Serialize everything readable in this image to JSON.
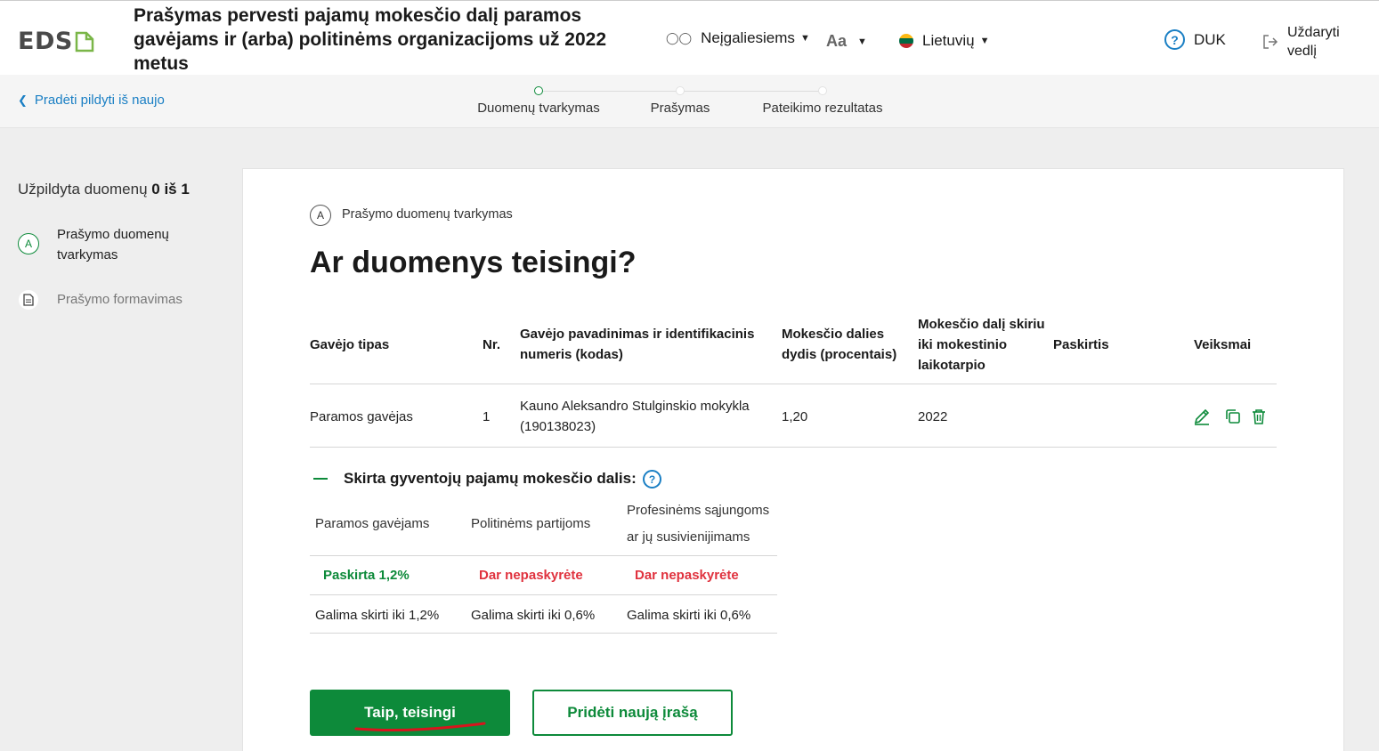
{
  "header": {
    "logo_text": "EDS",
    "title": "Prašymas pervesti pajamų mokesčio dalį paramos gavėjams ir (arba) politinėms organizacijoms už 2022 metus",
    "accessibility_label": "Neįgaliesiems",
    "font_size_label": "Aa",
    "language_label": "Lietuvių",
    "faq_label": "DUK",
    "close_label": "Uždaryti vedlį"
  },
  "stepper": {
    "restart_label": "Pradėti pildyti iš naujo",
    "steps": [
      {
        "label": "Duomenų tvarkymas",
        "active": true
      },
      {
        "label": "Prašymas",
        "active": false
      },
      {
        "label": "Pateikimo rezultatas",
        "active": false
      }
    ]
  },
  "sidebar": {
    "filled_prefix": "Užpildyta duomenų",
    "filled_count": "0 iš 1",
    "items": [
      {
        "badge": "A",
        "label": "Prašymo duomenų tvarkymas"
      },
      {
        "label": "Prašymo formavimas"
      }
    ]
  },
  "main": {
    "section_badge": "A",
    "section_label": "Prašymo duomenų tvarkymas",
    "question": "Ar duomenys teisingi?",
    "table": {
      "headers": [
        "Gavėjo tipas",
        "Nr.",
        "Gavėjo pavadinimas ir identifikacinis numeris (kodas)",
        "Mokesčio dalies dydis (procentais)",
        "Mokesčio dalį skiriu iki mokestinio laikotarpio",
        "Paskirtis",
        "Veiksmai"
      ],
      "rows": [
        {
          "type": "Paramos gavėjas",
          "nr": "1",
          "name": "Kauno Aleksandro Stulginskio mokykla (190138023)",
          "percent": "1,20",
          "until": "2022",
          "purpose": ""
        }
      ]
    },
    "allocation": {
      "title": "Skirta gyventojų pajamų mokesčio dalis:",
      "columns": [
        {
          "header": "Paramos gavėjams",
          "status": "Paskirta 1,2%",
          "status_color": "#0d8a3a",
          "limit": "Galima skirti iki 1,2%"
        },
        {
          "header": "Politinėms partijoms",
          "status": "Dar nepaskyrėte",
          "status_color": "#e0323e",
          "limit": "Galima skirti iki 0,6%"
        },
        {
          "header": "Profesinėms sąjungoms ar jų susivienijimams",
          "status": "Dar nepaskyrėte",
          "status_color": "#e0323e",
          "limit": "Galima skirti iki 0,6%"
        }
      ]
    },
    "buttons": {
      "confirm": "Taip, teisingi",
      "add": "Pridėti naują įrašą"
    }
  },
  "colors": {
    "accent_green": "#0d8a3a",
    "link_blue": "#1a7fc4",
    "alert_red": "#e0323e"
  },
  "icons": [
    "glasses-icon",
    "caret-down-icon",
    "lithuania-flag-icon",
    "question-icon",
    "exit-icon",
    "chevron-left-icon",
    "document-icon",
    "edit-icon",
    "copy-icon",
    "trash-icon",
    "minus-icon"
  ]
}
